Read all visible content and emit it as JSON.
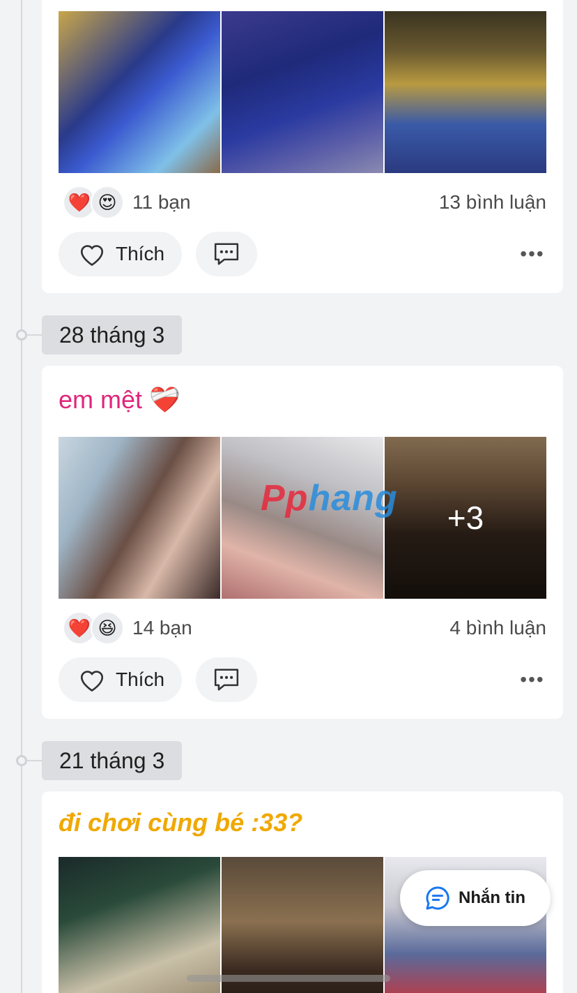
{
  "posts": [
    {
      "caption": "",
      "reaction_icons": [
        "heart-emoji",
        "heart-eyes-emoji"
      ],
      "reaction_glyphs": [
        "❤️",
        "😍"
      ],
      "reaction_count": "11 bạn",
      "comment_count": "13 bình luận",
      "like_label": "Thích",
      "photos": [
        "cinema-poster-photo",
        "cinema-lounge-photo",
        "cinema-lobby-photo"
      ]
    },
    {
      "date": "28 tháng 3",
      "caption": "em mệt ❤️‍🩹",
      "caption_color": "#e0267a",
      "watermark": "Pphang",
      "reaction_icons": [
        "heart-emoji",
        "laughing-emoji"
      ],
      "reaction_glyphs": [
        "❤️",
        "😆"
      ],
      "reaction_count": "14 bạn",
      "comment_count": "4 bình luận",
      "like_label": "Thích",
      "more_photos": "+3",
      "photos": [
        "window-portrait-photo",
        "lying-portrait-photo",
        "beach-silhouette-photo"
      ]
    },
    {
      "date": "21 tháng 3",
      "caption": "đi chơi cùng bé :33?",
      "caption_color": "#f0a800",
      "photos": [
        "cafe-night-photo",
        "street-mirror-photo",
        "store-portrait-photo"
      ]
    }
  ],
  "chat_button": {
    "label": "Nhắn tin"
  },
  "colors": {
    "background": "#f2f3f5",
    "card": "#ffffff",
    "accent_blue": "#1877f2"
  }
}
